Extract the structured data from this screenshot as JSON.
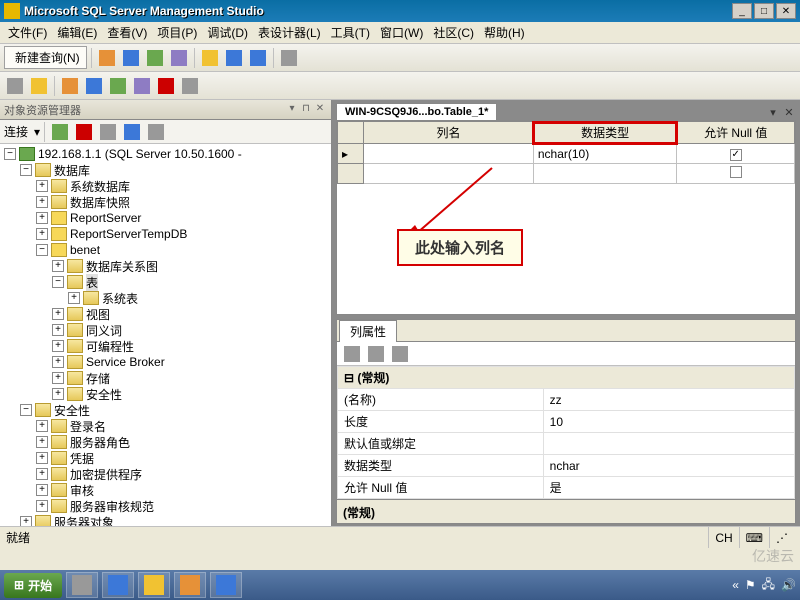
{
  "window": {
    "title": "Microsoft SQL Server Management Studio"
  },
  "menu": {
    "file": "文件(F)",
    "edit": "编辑(E)",
    "view": "查看(V)",
    "project": "项目(P)",
    "debug": "调试(D)",
    "designer": "表设计器(L)",
    "tools": "工具(T)",
    "window": "窗口(W)",
    "community": "社区(C)",
    "help": "帮助(H)"
  },
  "toolbar": {
    "newquery": "新建查询(N)"
  },
  "explorer": {
    "title": "对象资源管理器",
    "connect": "连接",
    "server": "192.168.1.1 (SQL Server 10.50.1600 -",
    "nodes": {
      "databases": "数据库",
      "sysdbs": "系统数据库",
      "snapshots": "数据库快照",
      "reportserver": "ReportServer",
      "reportservertemp": "ReportServerTempDB",
      "benet": "benet",
      "diagrams": "数据库关系图",
      "tables": "表",
      "systables": "系统表",
      "views": "视图",
      "synonyms": "同义词",
      "programmability": "可编程性",
      "servicebroker": "Service Broker",
      "storage": "存储",
      "security_db": "安全性",
      "security": "安全性",
      "logins": "登录名",
      "serverroles": "服务器角色",
      "credentials": "凭据",
      "cryptoproviders": "加密提供程序",
      "audits": "审核",
      "auditspecs": "服务器审核规范",
      "serverobjects": "服务器对象"
    }
  },
  "designer": {
    "tab": "WIN-9CSQ9J6...bo.Table_1*",
    "headers": {
      "colname": "列名",
      "datatype": "数据类型",
      "allownull": "允许 Null 值"
    },
    "rows": [
      {
        "name": "",
        "type": "nchar(10)",
        "null": true
      },
      {
        "name": "",
        "type": "",
        "null": false
      }
    ],
    "annotation": "此处输入列名"
  },
  "props": {
    "title": "列属性",
    "group": "(常规)",
    "rows": {
      "name_k": "(名称)",
      "name_v": "zz",
      "len_k": "长度",
      "len_v": "10",
      "default_k": "默认值或绑定",
      "default_v": "",
      "type_k": "数据类型",
      "type_v": "nchar",
      "null_k": "允许 Null 值",
      "null_v": "是"
    },
    "footer": "(常规)"
  },
  "status": {
    "ready": "就绪",
    "lang": "CH"
  },
  "taskbar": {
    "start": "开始"
  },
  "watermark": "亿速云"
}
